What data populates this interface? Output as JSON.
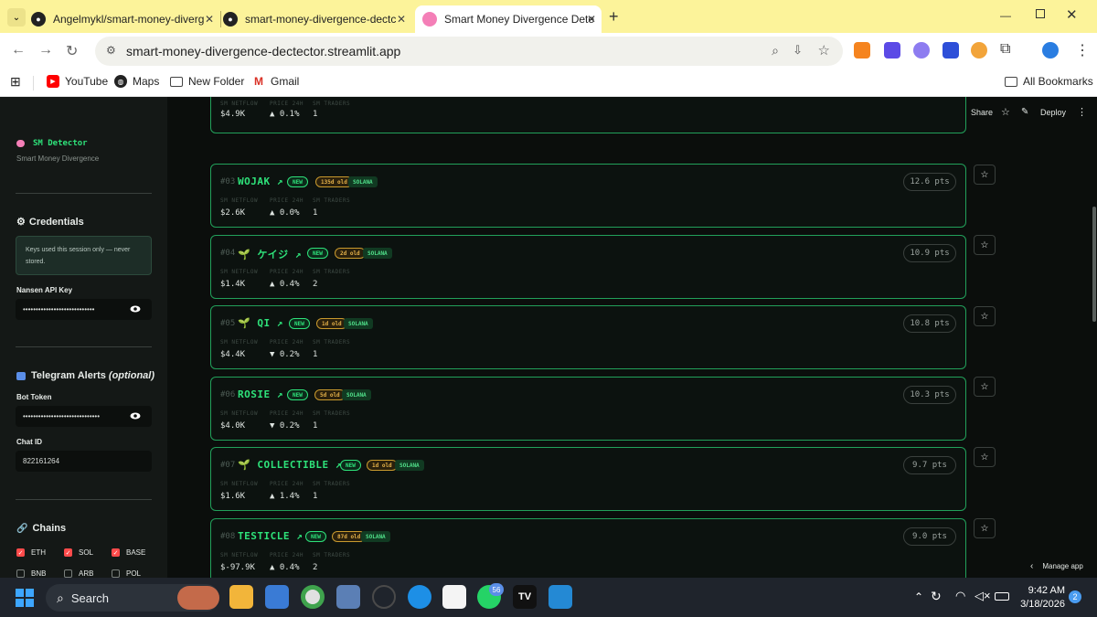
{
  "browser": {
    "tabs": [
      {
        "title": "Angelmykl/smart-money-diverg"
      },
      {
        "title": "smart-money-divergence-dectc"
      },
      {
        "title": "Smart Money Divergence Dete"
      }
    ],
    "url": "smart-money-divergence-dectector.streamlit.app",
    "bookmarks": [
      "YouTube",
      "Maps",
      "New Folder",
      "Gmail"
    ],
    "all_bookmarks": "All Bookmarks"
  },
  "app_header": {
    "share": "Share",
    "deploy": "Deploy"
  },
  "sidebar": {
    "brand": "SM Detector",
    "brand_sub": "Smart Money Divergence",
    "credentials_title": "Credentials",
    "credentials_note": "Keys used this session only — never stored.",
    "nansen_label": "Nansen API Key",
    "nansen_value": "••••••••••••••••••••••••••••",
    "telegram_title": "Telegram Alerts",
    "telegram_optional": "(optional)",
    "bot_token_label": "Bot Token",
    "bot_token_value": "••••••••••••••••••••••••••••••",
    "chat_id_label": "Chat ID",
    "chat_id_value": "822161264",
    "chains_title": "Chains",
    "chains": [
      {
        "label": "ETH",
        "checked": true
      },
      {
        "label": "SOL",
        "checked": true
      },
      {
        "label": "BASE",
        "checked": true
      },
      {
        "label": "BNB",
        "checked": false
      },
      {
        "label": "ARB",
        "checked": false
      },
      {
        "label": "POL",
        "checked": false
      }
    ]
  },
  "field_labels": {
    "netflow": "SM NETFLOW",
    "price": "PRICE 24H",
    "traders": "SM TRADERS"
  },
  "partial_card": {
    "netflow": "$4.9K",
    "price": "▲ 0.1%",
    "traders": "1"
  },
  "cards": [
    {
      "rank": "#03",
      "symbol": "WOJAK ↗",
      "new": "NEW",
      "age": "135d old",
      "chain": "SOLANA",
      "netflow": "$2.6K",
      "price": "▲ 0.0%",
      "dir": "up",
      "traders": "1",
      "pts": "12.6 pts"
    },
    {
      "rank": "#04",
      "symbol": "🌱 ケイジ ↗",
      "new": "NEW",
      "age": "2d old",
      "chain": "SOLANA",
      "netflow": "$1.4K",
      "price": "▲ 0.4%",
      "dir": "up",
      "traders": "2",
      "pts": "10.9 pts"
    },
    {
      "rank": "#05",
      "symbol": "🌱 QI ↗",
      "new": "NEW",
      "age": "1d old",
      "chain": "SOLANA",
      "netflow": "$4.4K",
      "price": "▼ 0.2%",
      "dir": "down",
      "traders": "1",
      "pts": "10.8 pts"
    },
    {
      "rank": "#06",
      "symbol": "ROSIE ↗",
      "new": "NEW",
      "age": "5d old",
      "chain": "SOLANA",
      "netflow": "$4.0K",
      "price": "▼ 0.2%",
      "dir": "down",
      "traders": "1",
      "pts": "10.3 pts"
    },
    {
      "rank": "#07",
      "symbol": "🌱 COLLECTIBLE ↗",
      "new": "NEW",
      "age": "1d old",
      "chain": "SOLANA",
      "netflow": "$1.6K",
      "price": "▲ 1.4%",
      "dir": "up",
      "traders": "1",
      "pts": "9.7 pts"
    },
    {
      "rank": "#08",
      "symbol": "TESTICLE ↗",
      "new": "NEW",
      "age": "87d old",
      "chain": "SOLANA",
      "netflow": "$-97.9K",
      "price": "▲ 0.4%",
      "dir": "up",
      "traders": "2",
      "pts": "9.0 pts"
    }
  ],
  "manage_app": "Manage app",
  "taskbar": {
    "search": "Search",
    "badge": "56",
    "time": "9:42 AM",
    "date": "3/18/2026",
    "notif": "2"
  }
}
